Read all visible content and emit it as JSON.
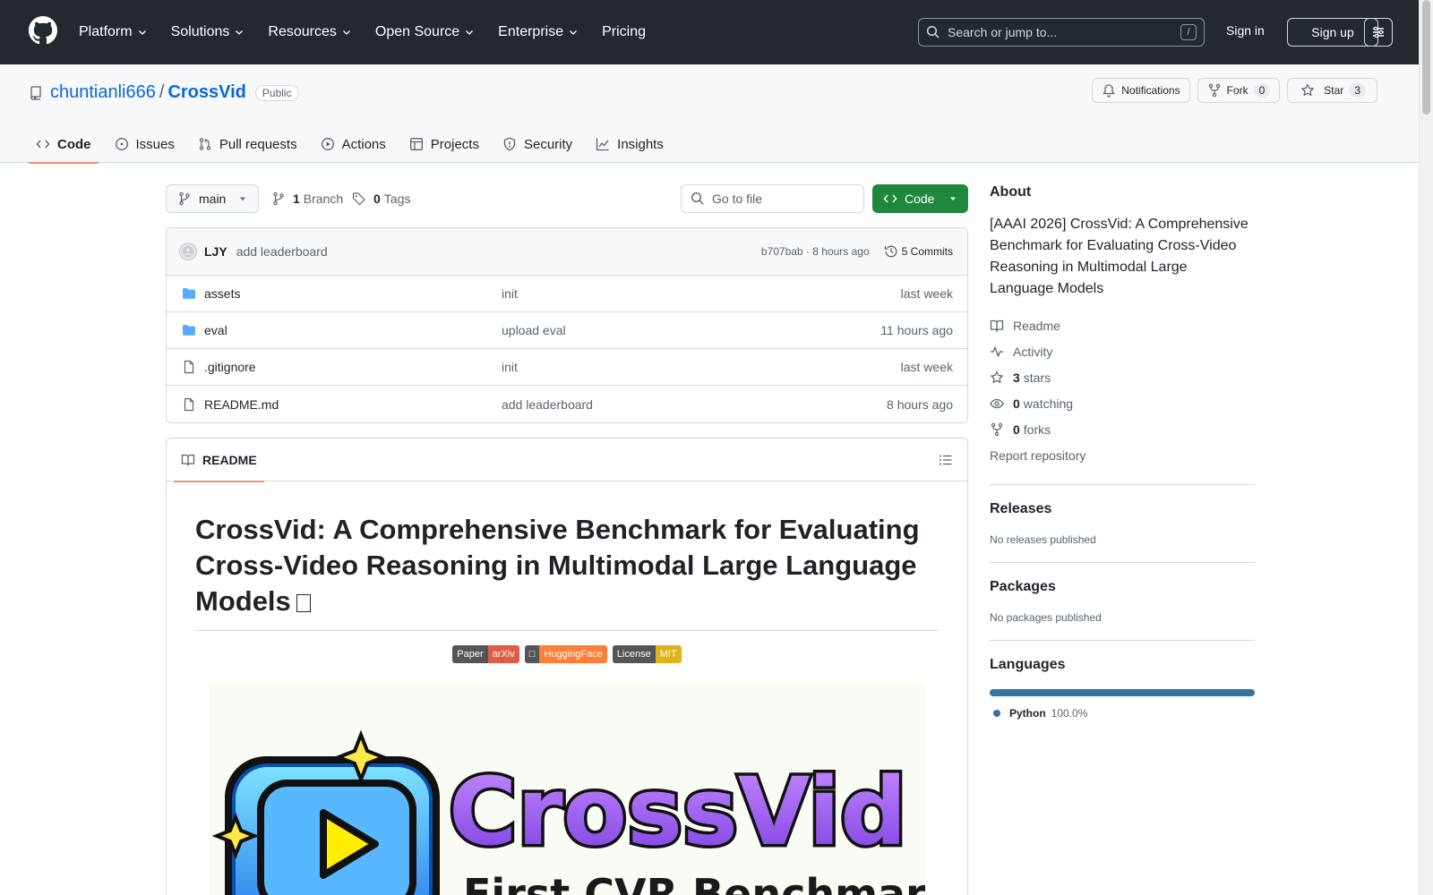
{
  "header": {
    "nav": [
      {
        "label": "Platform",
        "chevron": true
      },
      {
        "label": "Solutions",
        "chevron": true
      },
      {
        "label": "Resources",
        "chevron": true
      },
      {
        "label": "Open Source",
        "chevron": true
      },
      {
        "label": "Enterprise",
        "chevron": true
      },
      {
        "label": "Pricing",
        "chevron": false
      }
    ],
    "search_placeholder": "Search or jump to...",
    "search_shortcut": "/",
    "signin": "Sign in",
    "signup": "Sign up"
  },
  "repo": {
    "owner": "chuntianli666",
    "separator": "/",
    "name": "CrossVid",
    "visibility": "Public",
    "notifications": "Notifications",
    "fork_label": "Fork",
    "fork_count": "0",
    "star_label": "Star",
    "star_count": "3"
  },
  "tabs": [
    "Code",
    "Issues",
    "Pull requests",
    "Actions",
    "Projects",
    "Security",
    "Insights"
  ],
  "toolbar": {
    "branch": "main",
    "branches_count": "1",
    "branches_label": "Branch",
    "tags_count": "0",
    "tags_label": "Tags",
    "goto_placeholder": "Go to file",
    "code_button": "Code"
  },
  "commit": {
    "author": "LJY",
    "message": "add leaderboard",
    "hash_time": "b707bab · 8 hours ago",
    "commits": "5 Commits"
  },
  "files": [
    {
      "name": "assets",
      "type": "folder",
      "message": "init",
      "time": "last week"
    },
    {
      "name": "eval",
      "type": "folder",
      "message": "upload eval",
      "time": "11 hours ago"
    },
    {
      "name": ".gitignore",
      "type": "file",
      "message": "init",
      "time": "last week"
    },
    {
      "name": "README.md",
      "type": "file",
      "message": "add leaderboard",
      "time": "8 hours ago"
    }
  ],
  "readme": {
    "tab": "README",
    "title": "CrossVid: A Comprehensive Benchmark for Evaluating Cross-Video Reasoning in Multimodal Large Language Models",
    "badges": [
      {
        "left": "Paper",
        "right": "arXiv",
        "color": "#e05d44"
      },
      {
        "left": "□",
        "right": "HuggingFace",
        "color": "#fe7d37"
      },
      {
        "left": "License",
        "right": "MIT",
        "color": "#dfb317"
      }
    ],
    "banner_title": "CrossVid",
    "banner_subtitle": "First CVR Benchmark"
  },
  "about": {
    "heading": "About",
    "description": "[AAAI 2026] CrossVid: A Comprehensive Benchmark for Evaluating Cross-Video Reasoning in Multimodal Large Language Models",
    "readme": "Readme",
    "activity": "Activity",
    "stars_count": "3",
    "stars_label": "stars",
    "watching_count": "0",
    "watching_label": "watching",
    "forks_count": "0",
    "forks_label": "forks",
    "report": "Report repository"
  },
  "releases": {
    "heading": "Releases",
    "note": "No releases published"
  },
  "packages": {
    "heading": "Packages",
    "note": "No packages published"
  },
  "languages": {
    "heading": "Languages",
    "name": "Python",
    "percent": "100.0%",
    "color": "#3572A5"
  }
}
